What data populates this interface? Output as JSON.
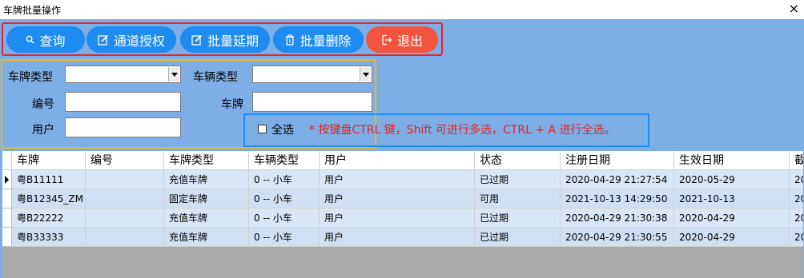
{
  "window": {
    "title": "车牌批量操作",
    "close": "×"
  },
  "toolbar": {
    "query": "查询",
    "authorize": "通道授权",
    "extend": "批量延期",
    "delete": "批量删除",
    "exit": "退出",
    "colors": {
      "primary": "#1d8bf0",
      "exit": "#f3543e",
      "frame": "#e3262a"
    }
  },
  "filters": {
    "plate_type_label": "车牌类型",
    "vehicle_type_label": "车辆类型",
    "number_label": "编号",
    "plate_label": "车牌",
    "user_label": "用户",
    "plate_type_value": "",
    "vehicle_type_value": "",
    "number_value": "",
    "plate_value": "",
    "user_value": ""
  },
  "select_all": {
    "label": "全选",
    "checked": false,
    "hint": "* 按键盘CTRL 键，Shift 可进行多选，CTRL + A 进行全选。"
  },
  "table": {
    "columns": [
      "车牌",
      "编号",
      "车牌类型",
      "车辆类型",
      "用户",
      "状态",
      "注册日期",
      "生效日期",
      "截"
    ],
    "rows": [
      [
        "粤B11111",
        "",
        "充值车牌",
        "0 -- 小车",
        "用户",
        "已过期",
        "2020-04-29 21:27:54",
        "2020-05-29",
        "20"
      ],
      [
        "粤B12345_ZM",
        "",
        "固定车牌",
        "0 -- 小车",
        "用户",
        "可用",
        "2021-10-13 14:29:50",
        "2021-10-13",
        "20"
      ],
      [
        "粤B22222",
        "",
        "充值车牌",
        "0 -- 小车",
        "用户",
        "已过期",
        "2020-04-29 21:30:38",
        "2020-04-29",
        "20"
      ],
      [
        "粤B33333",
        "",
        "充值车牌",
        "0 -- 小车",
        "用户",
        "已过期",
        "2020-04-29 21:30:55",
        "2020-04-29",
        "20"
      ]
    ]
  }
}
